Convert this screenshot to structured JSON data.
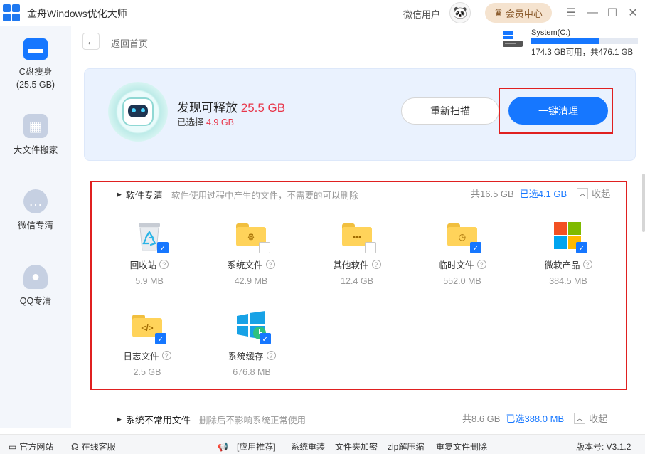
{
  "app": {
    "title": "金舟Windows优化大师",
    "user_label": "微信用户",
    "vip_label": "会员中心"
  },
  "sidebar": {
    "items": [
      {
        "label": "C盘瘦身",
        "sub": "(25.5 GB)"
      },
      {
        "label": "大文件搬家"
      },
      {
        "label": "微信专清"
      },
      {
        "label": "QQ专清"
      }
    ]
  },
  "header": {
    "back_label": "返回首页"
  },
  "disk": {
    "name": "System(C:)",
    "info": "174.3 GB可用，共476.1 GB",
    "used_fraction": 0.634
  },
  "summary": {
    "found_label": "发现可释放",
    "found_value": "25.5 GB",
    "selected_label": "已选择",
    "selected_value": "4.9 GB",
    "rescan_label": "重新扫描",
    "clean_label": "一键清理"
  },
  "section1": {
    "title": "软件专清",
    "desc": "软件使用过程中产生的文件，不需要的可以删除",
    "total": "共16.5 GB",
    "selected": "已选4.1 GB",
    "collapse": "收起",
    "items": [
      {
        "name": "回收站",
        "size": "5.9 MB",
        "checked": true
      },
      {
        "name": "系统文件",
        "size": "42.9 MB",
        "checked": false
      },
      {
        "name": "其他软件",
        "size": "12.4 GB",
        "checked": false
      },
      {
        "name": "临时文件",
        "size": "552.0 MB",
        "checked": true
      },
      {
        "name": "微软产品",
        "size": "384.5 MB",
        "checked": true
      },
      {
        "name": "日志文件",
        "size": "2.5 GB",
        "checked": true
      },
      {
        "name": "系统缓存",
        "size": "676.8 MB",
        "checked": true
      }
    ]
  },
  "section2": {
    "title": "系统不常用文件",
    "desc": "删除后不影响系统正常使用",
    "total": "共8.6 GB",
    "selected": "已选388.0 MB",
    "collapse": "收起"
  },
  "footer": {
    "website": "官方网站",
    "service": "在线客服",
    "recommend": "[应用推荐]",
    "links": [
      "系统重装",
      "文件夹加密",
      "zip解压缩",
      "重复文件删除"
    ],
    "version": "版本号: V3.1.2"
  },
  "colors": {
    "accent": "#1677ff",
    "highlight": "#e8364a",
    "sidebar_bg": "#f3f6fb",
    "banner_bg": "#eaf2fe"
  }
}
